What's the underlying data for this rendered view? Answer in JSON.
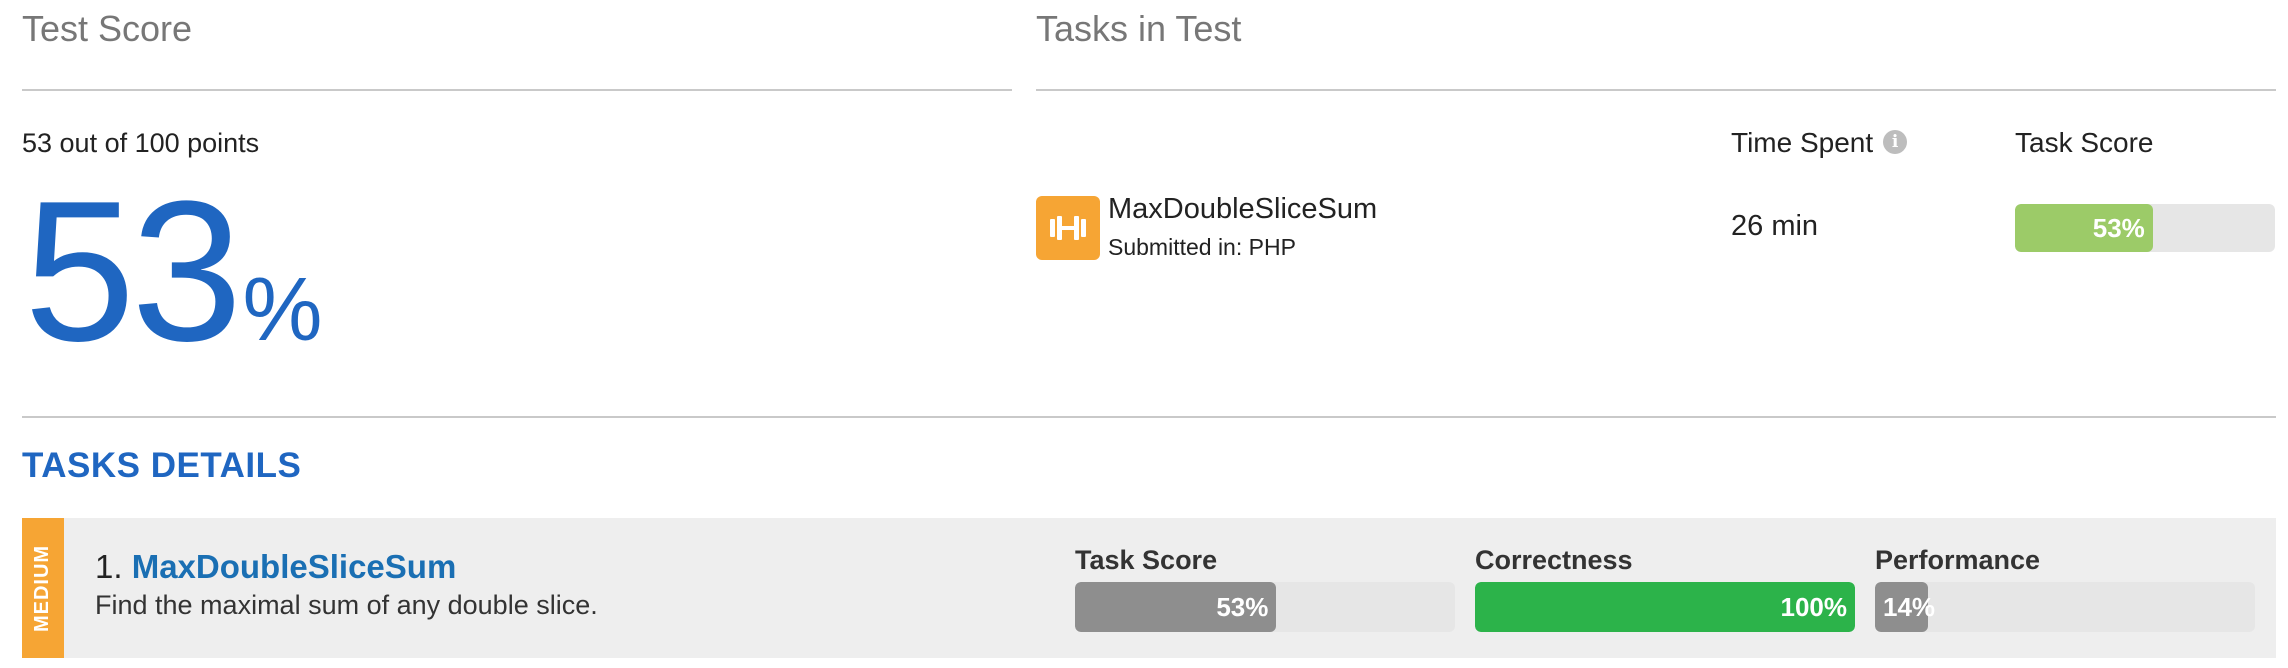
{
  "test_score": {
    "heading": "Test Score",
    "points_text": "53 out of 100 points",
    "percent_value": "53",
    "percent_sign": "%"
  },
  "tasks_in_test": {
    "heading": "Tasks in Test",
    "columns": {
      "time_spent": "Time Spent",
      "task_score": "Task Score"
    },
    "info_icon": "info-icon",
    "rows": [
      {
        "icon": "dumbbell-icon",
        "name": "MaxDoubleSliceSum",
        "submitted": "Submitted in: PHP",
        "time": "26 min",
        "score_label": "53%",
        "score_fraction": 0.53,
        "bar_color": "#9ccb68"
      }
    ]
  },
  "tasks_details": {
    "heading": "TASKS DETAILS",
    "items": [
      {
        "difficulty": "MEDIUM",
        "difficulty_color": "#f6a534",
        "number": "1.",
        "name": "MaxDoubleSliceSum",
        "description": "Find the maximal sum of any double slice.",
        "metrics": {
          "task_score": {
            "label": "Task Score",
            "value": "53%",
            "fraction": 0.53,
            "color": "#8e8e8e"
          },
          "correctness": {
            "label": "Correctness",
            "value": "100%",
            "fraction": 1.0,
            "color": "#2cb34a"
          },
          "performance": {
            "label": "Performance",
            "value": "14%",
            "fraction": 0.14,
            "color": "#8e8e8e"
          }
        }
      }
    ]
  }
}
